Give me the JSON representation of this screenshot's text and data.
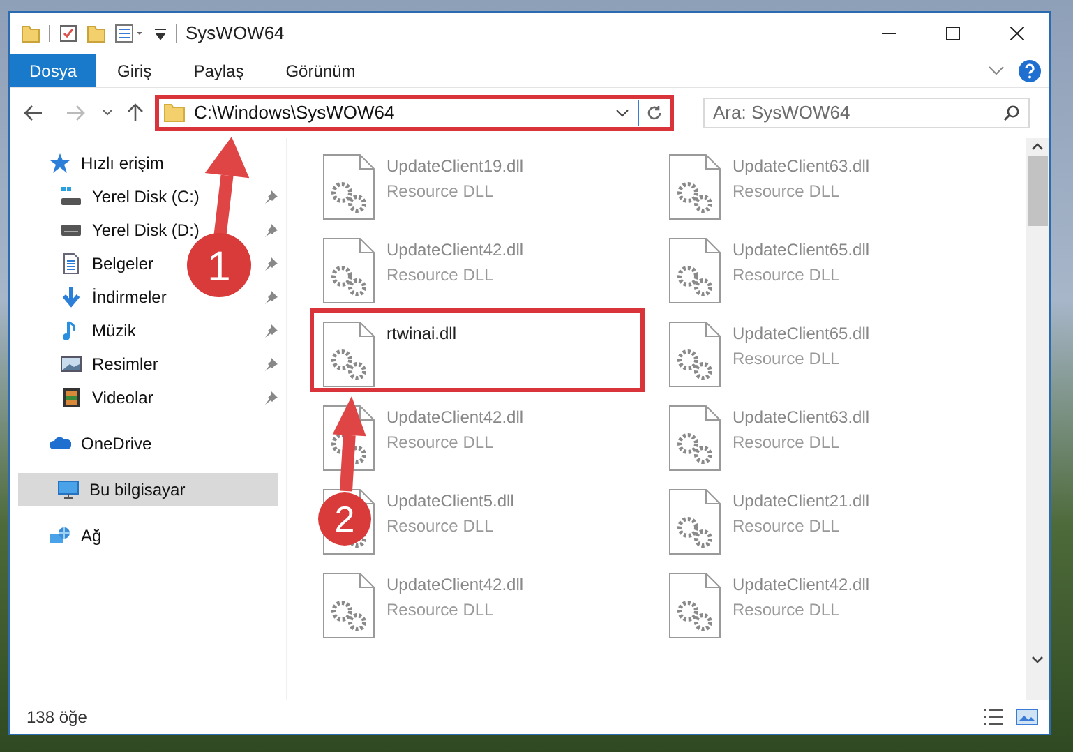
{
  "window": {
    "title": "SysWOW64"
  },
  "ribbon_tabs": [
    {
      "label": "Dosya",
      "kind": "file",
      "selected": false
    },
    {
      "label": "Giriş",
      "kind": "tab",
      "selected": false
    },
    {
      "label": "Paylaş",
      "kind": "tab",
      "selected": false
    },
    {
      "label": "Görünüm",
      "kind": "tab",
      "selected": false
    }
  ],
  "address_bar": {
    "path": "C:\\Windows\\SysWOW64",
    "highlighted": true
  },
  "search": {
    "placeholder": "Ara: SysWOW64"
  },
  "sidebar": {
    "items": [
      {
        "label": "Hızlı erişim",
        "kind": "star",
        "selected": false,
        "children": [
          {
            "label": "Yerel Disk (C:)",
            "kind": "drive-c",
            "pinned": true
          },
          {
            "label": "Yerel Disk (D:)",
            "kind": "drive",
            "pinned": true
          },
          {
            "label": "Belgeler",
            "kind": "docs",
            "pinned": true
          },
          {
            "label": "İndirmeler",
            "kind": "download",
            "pinned": true
          },
          {
            "label": "Müzik",
            "kind": "music",
            "pinned": true
          },
          {
            "label": "Resimler",
            "kind": "pictures",
            "pinned": true
          },
          {
            "label": "Videolar",
            "kind": "video",
            "pinned": true
          }
        ]
      },
      {
        "label": "OneDrive",
        "kind": "cloud",
        "selected": false
      },
      {
        "label": "Bu bilgisayar",
        "kind": "pc",
        "selected": true
      },
      {
        "label": "Ağ",
        "kind": "network",
        "selected": false
      }
    ]
  },
  "files": [
    {
      "name": "UpdateClient19.dll",
      "type": "Resource DLL",
      "highlighted": false
    },
    {
      "name": "UpdateClient63.dll",
      "type": "Resource DLL",
      "highlighted": false
    },
    {
      "name": "UpdateClient42.dll",
      "type": "Resource DLL",
      "highlighted": false
    },
    {
      "name": "UpdateClient65.dll",
      "type": "Resource DLL",
      "highlighted": false
    },
    {
      "name": "rtwinai.dll",
      "highlighted": true
    },
    {
      "name": "UpdateClient65.dll",
      "type": "Resource DLL",
      "highlighted": false
    },
    {
      "name": "UpdateClient42.dll",
      "type": "Resource DLL",
      "highlighted": false
    },
    {
      "name": "UpdateClient63.dll",
      "type": "Resource DLL",
      "highlighted": false
    },
    {
      "name": "UpdateClient5.dll",
      "type": "Resource DLL",
      "highlighted": false
    },
    {
      "name": "UpdateClient21.dll",
      "type": "Resource DLL",
      "highlighted": false
    },
    {
      "name": "UpdateClient42.dll",
      "type": "Resource DLL",
      "highlighted": false
    },
    {
      "name": "UpdateClient42.dll",
      "type": "Resource DLL",
      "highlighted": false
    }
  ],
  "callouts": [
    {
      "number": "1"
    },
    {
      "number": "2"
    }
  ],
  "status_bar": {
    "count": "138 öğe"
  }
}
